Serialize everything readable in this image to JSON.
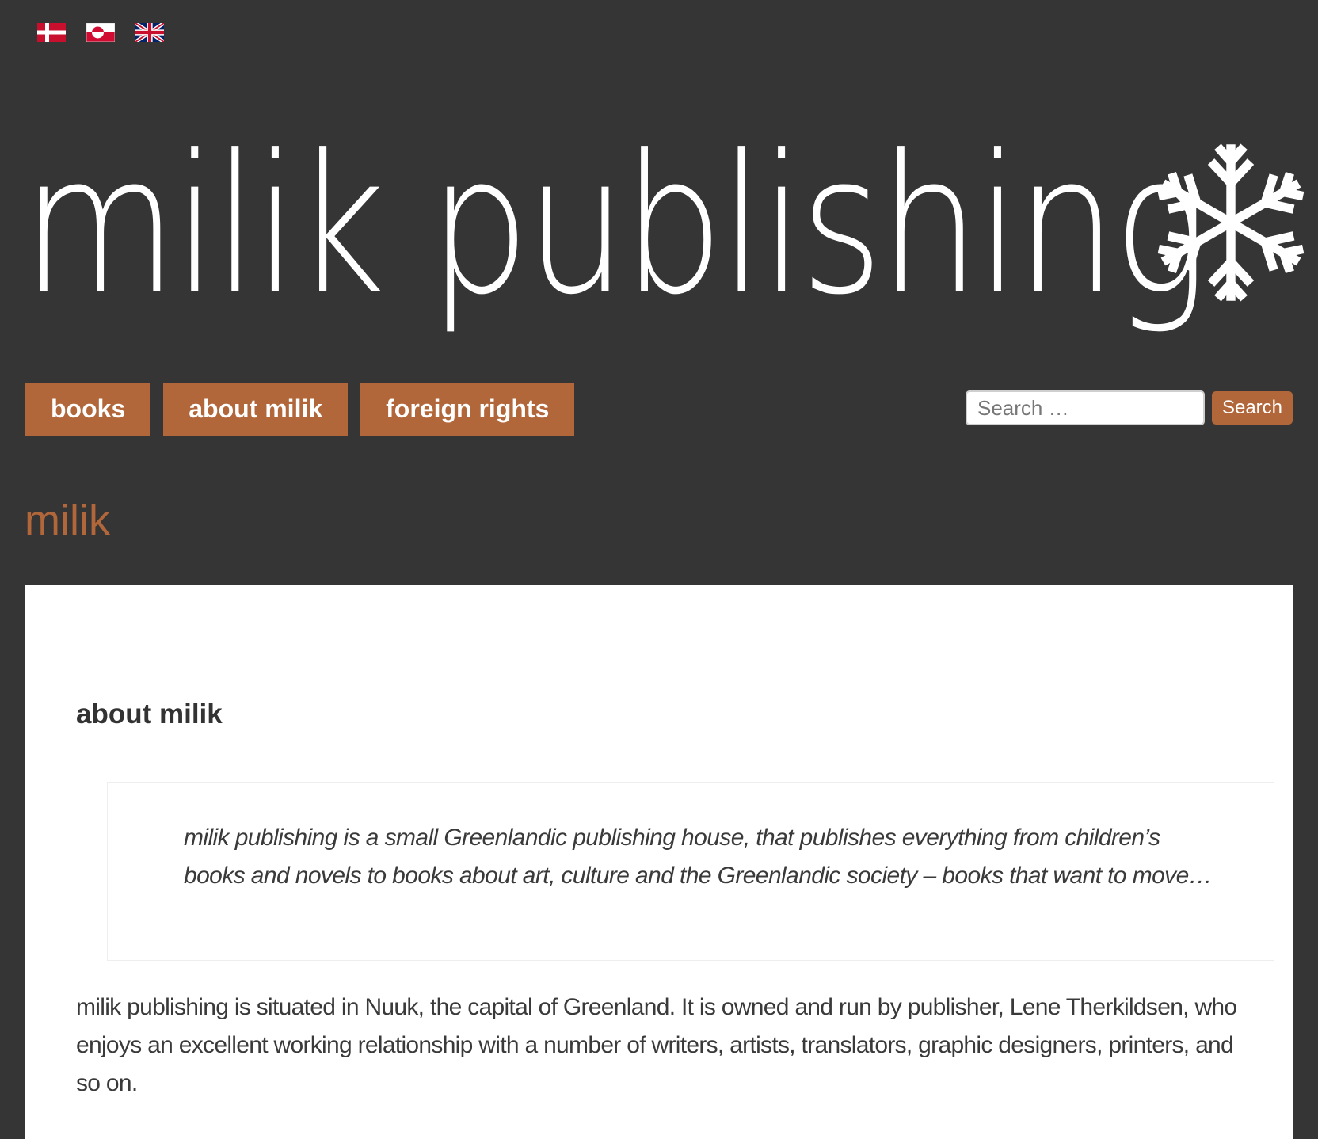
{
  "language_switcher": {
    "items": [
      {
        "name": "danish-flag-icon",
        "colors": [
          "#c8102e",
          "#ffffff"
        ]
      },
      {
        "name": "greenlandic-flag-icon",
        "colors": [
          "#ffffff",
          "#d00c33"
        ]
      },
      {
        "name": "uk-flag-icon",
        "colors": [
          "#012169",
          "#ffffff",
          "#c8102e"
        ]
      }
    ]
  },
  "logo": {
    "text": "milik publishing",
    "icon": "snowflake-icon"
  },
  "nav": {
    "items": [
      {
        "label": "books"
      },
      {
        "label": "about milik"
      },
      {
        "label": "foreign rights"
      }
    ]
  },
  "search": {
    "placeholder": "Search …",
    "button_label": "Search"
  },
  "site_title": "milik",
  "page": {
    "heading": "about milik",
    "quote": "milik publishing is a small Greenlandic publishing house, that publishes everything from children’s books and novels to books about art, culture and the Greenlandic society – books that want to move…",
    "paragraph": "milik publishing is situated in Nuuk, the capital of Greenland. It is owned and run by publisher, Lene Therkildsen, who enjoys an excellent working relationship with a number of writers, artists, translators, graphic designers, printers, and so on."
  },
  "colors": {
    "background": "#353535",
    "accent": "#b1673a",
    "content_background": "#ffffff",
    "text": "#3a3a3a"
  }
}
